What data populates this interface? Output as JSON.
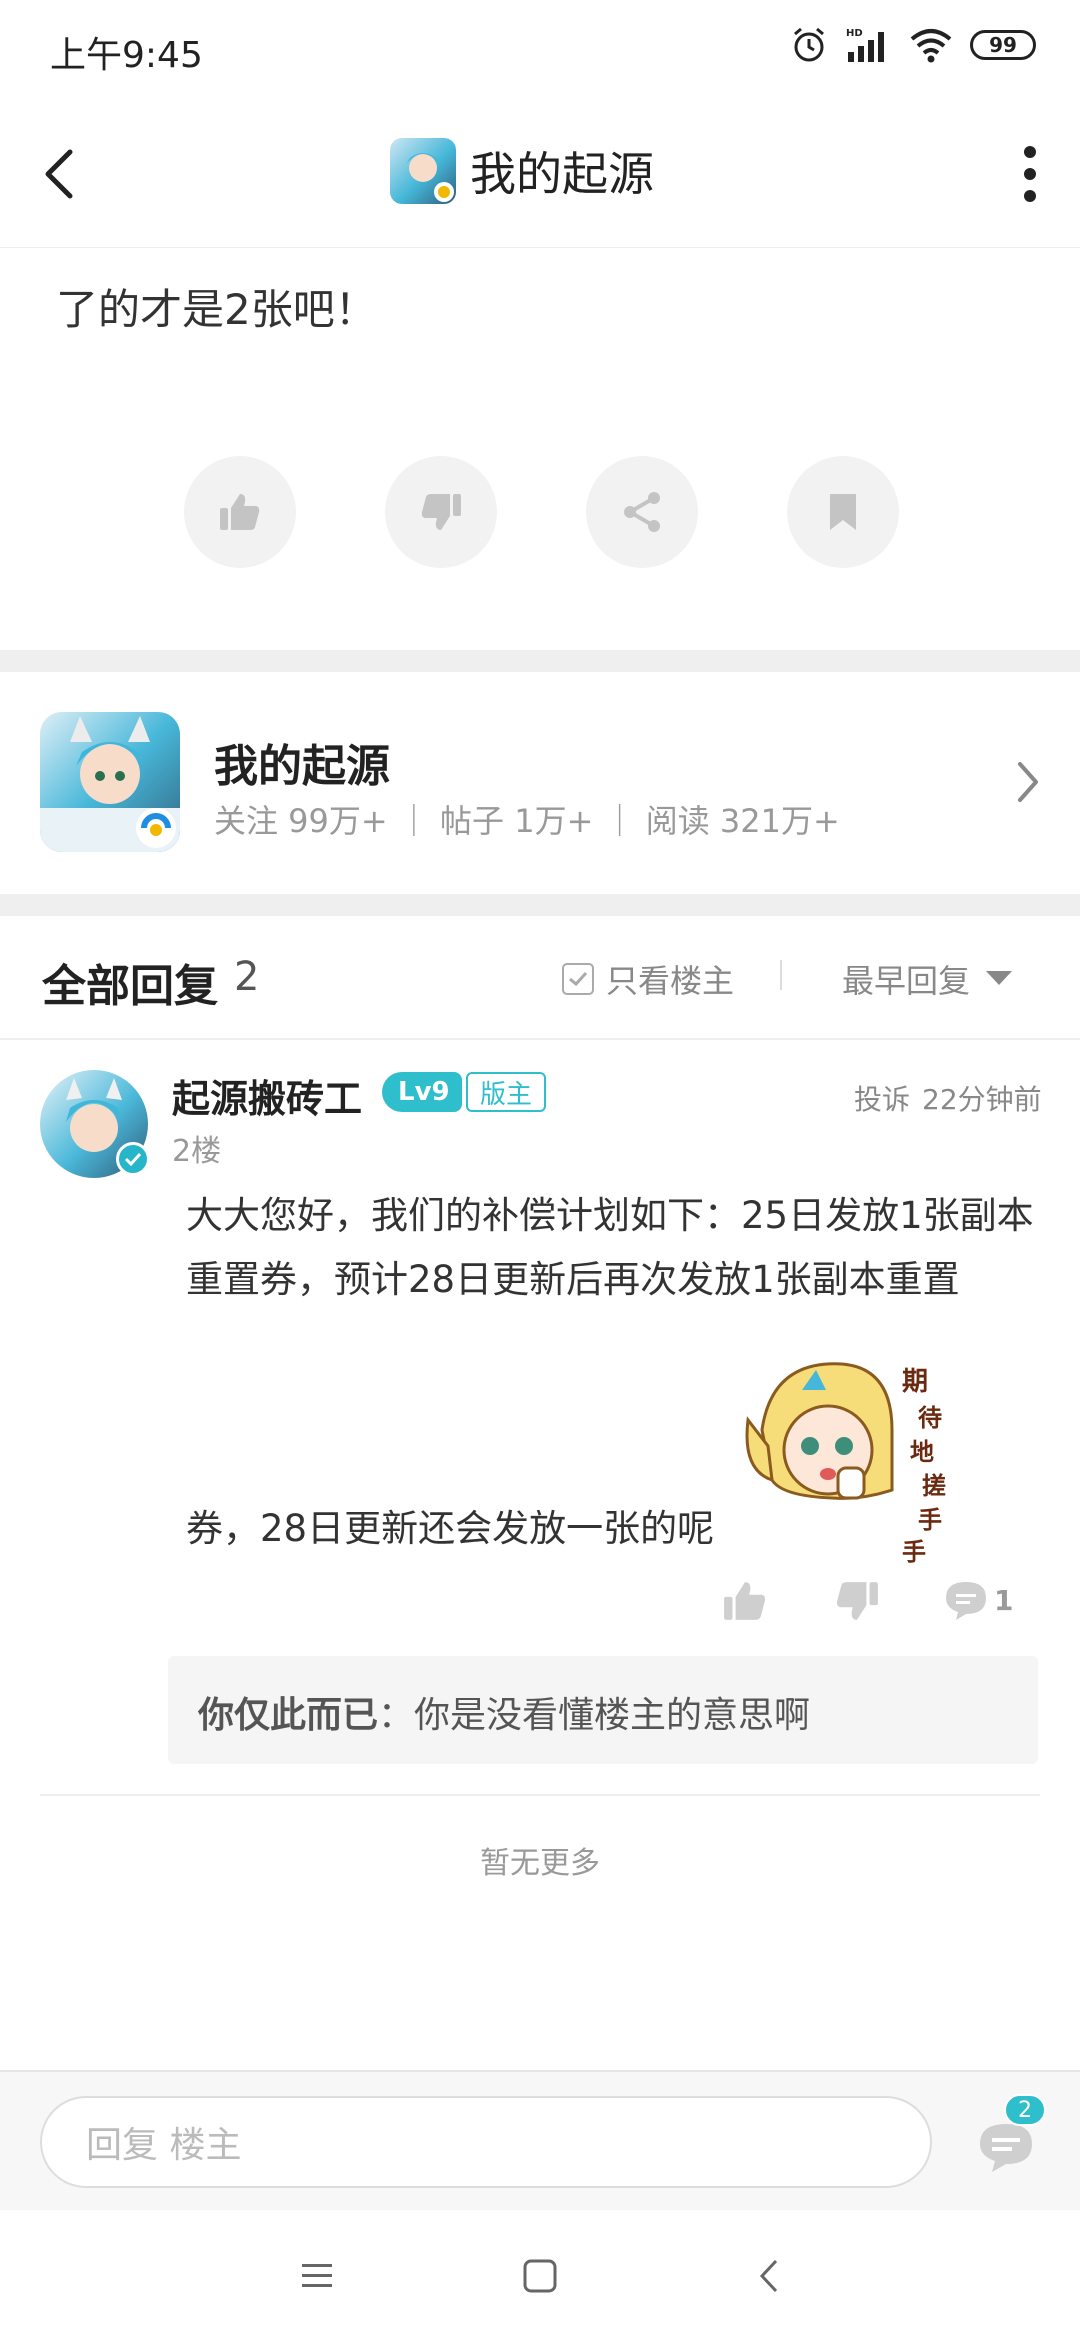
{
  "status_bar": {
    "time": "上午9:45",
    "battery": "99",
    "icons": [
      "alarm-icon",
      "hd-signal-icon",
      "wifi-icon",
      "battery-icon"
    ]
  },
  "header": {
    "title": "我的起源"
  },
  "post": {
    "text": "了的才是2张吧！"
  },
  "post_actions": [
    "thumbs-up-icon",
    "thumbs-down-icon",
    "share-icon",
    "bookmark-icon"
  ],
  "forum_card": {
    "name": "我的起源",
    "stats": "关注 99万+ ｜ 帖子 1万+ ｜ 阅读 321万+"
  },
  "replies_header": {
    "title": "全部回复",
    "count": "2",
    "only_op_label": "只看楼主",
    "sort_label": "最早回复"
  },
  "reply": {
    "username": "起源搬砖工",
    "level": "Lv9",
    "role_badge": "版主",
    "report_label": "投诉",
    "time_ago": "22分钟前",
    "floor": "2楼",
    "text_part1": "大大您好，我们的补偿计划如下：25日发放1张副本重置券，预计28日更新后再次发放1张副本重置",
    "text_part2": "券，28日更新还会发放一张的呢",
    "sticker_caption": "期待地搓手手",
    "comment_count": "1"
  },
  "sub_reply": {
    "author": "你仅此而已",
    "text": "：你是没看懂楼主的意思啊"
  },
  "footer_note": "暂无更多",
  "input_bar": {
    "placeholder": "回复  楼主",
    "comments_badge": "2"
  },
  "colors": {
    "accent": "#2fbecb",
    "divider": "#efefef",
    "muted_text": "#999999"
  }
}
